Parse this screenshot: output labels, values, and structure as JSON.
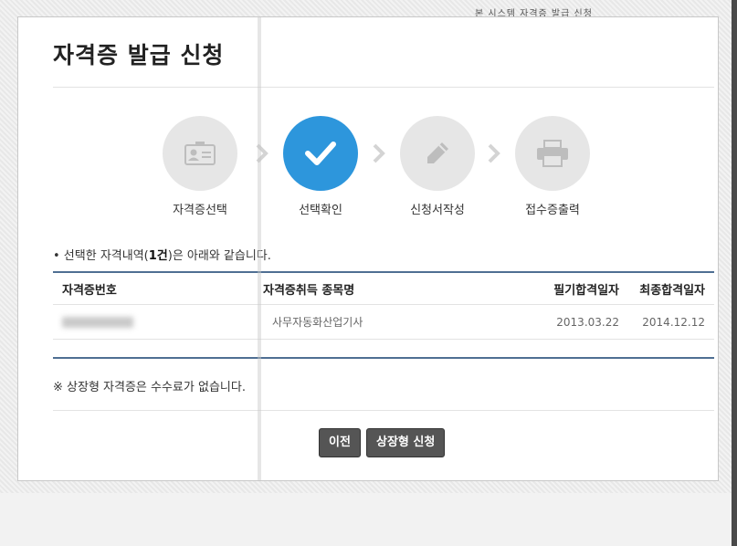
{
  "header_cut_text": "본 시스템 자격증 발급 신청",
  "dialog": {
    "title": "자격증 발급 신청"
  },
  "steps": [
    {
      "label": "자격증선택",
      "icon": "id-card-icon",
      "active": false
    },
    {
      "label": "선택확인",
      "icon": "checkmark-icon",
      "active": true
    },
    {
      "label": "신청서작성",
      "icon": "pencil-icon",
      "active": false
    },
    {
      "label": "접수증출력",
      "icon": "printer-icon",
      "active": false
    }
  ],
  "notice": {
    "prefix": "• 선택한 자격내역(",
    "count": "1건",
    "suffix": ")은 아래와 같습니다."
  },
  "table": {
    "headers": [
      "자격증번호",
      "자격증취득 종목명",
      "필기합격일자",
      "최종합격일자"
    ],
    "rows": [
      {
        "cert_no": "",
        "name": "사무자동화산업기사",
        "written_date": "2013.03.22",
        "final_date": "2014.12.12"
      }
    ]
  },
  "fee_note": "※ 상장형 자격증은 수수료가 없습니다.",
  "buttons": {
    "prev": "이전",
    "apply": "상장형 신청"
  },
  "colors": {
    "accent": "#2d96dc",
    "table_border": "#4f6f93",
    "button": "#555555",
    "step_inactive": "#e6e6e6"
  }
}
